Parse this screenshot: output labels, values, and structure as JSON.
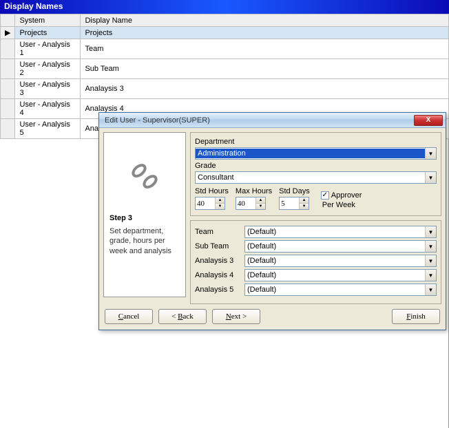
{
  "header": {
    "title": "Display Names"
  },
  "grid": {
    "columns": {
      "system": "System",
      "display": "Display Name"
    },
    "rows": [
      {
        "system": "Projects",
        "display": "Projects",
        "selected": true
      },
      {
        "system": "User - Analysis 1",
        "display": "Team"
      },
      {
        "system": "User - Analysis 2",
        "display": "Sub Team"
      },
      {
        "system": "User - Analysis 3",
        "display": "Analaysis 3"
      },
      {
        "system": "User - Analysis 4",
        "display": "Analaysis 4"
      },
      {
        "system": "User - Analysis 5",
        "display": "Analaysis 5"
      }
    ]
  },
  "dialog": {
    "title": "Edit User - Supervisor(SUPER)",
    "close": "X",
    "step": {
      "title": "Step 3",
      "desc": "Set department, grade, hours per week and analysis"
    },
    "labels": {
      "department": "Department",
      "grade": "Grade",
      "stdHours": "Std Hours",
      "maxHours": "Max Hours",
      "stdDays": "Std Days",
      "approver": "Approver",
      "perWeek": "Per Week"
    },
    "values": {
      "department": "Administration",
      "grade": "Consultant",
      "stdHours": "40",
      "maxHours": "40",
      "stdDays": "5",
      "approver": true
    },
    "analysis": [
      {
        "label": "Team",
        "value": "(Default)"
      },
      {
        "label": "Sub Team",
        "value": "(Default)"
      },
      {
        "label": "Analaysis 3",
        "value": "(Default)"
      },
      {
        "label": "Analaysis 4",
        "value": "(Default)"
      },
      {
        "label": "Analaysis 5",
        "value": "(Default)"
      }
    ],
    "buttons": {
      "cancel": "Cancel",
      "back": "Back",
      "next": "Next",
      "finish": "Finish"
    }
  }
}
